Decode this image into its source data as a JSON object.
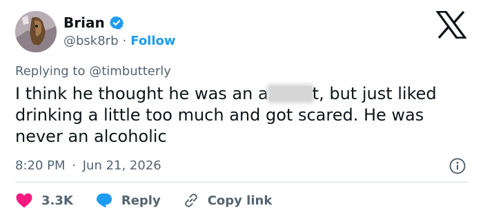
{
  "user": {
    "name": "Brian",
    "handle": "@bsk8rb",
    "separator": "·",
    "follow_label": "Follow"
  },
  "reply": {
    "prefix": "Replying to",
    "mention": "@timbutterly"
  },
  "tweet": {
    "text_before": "I think he thought he was an a",
    "text_after": "t, but just liked drinking a little too much and got scared. He was never an alcoholic"
  },
  "meta": {
    "time": "8:20 PM",
    "separator": "·",
    "date": "Jun 21, 2026"
  },
  "actions": {
    "likes": "3.3K",
    "reply_label": "Reply",
    "copy_label": "Copy link"
  },
  "colors": {
    "accent": "#1d9bf0",
    "like": "#f91880",
    "muted": "#536471",
    "text": "#0f1419"
  },
  "icons": [
    "verified-badge-icon",
    "x-logo-icon",
    "info-icon",
    "heart-icon",
    "reply-bubble-icon",
    "link-icon"
  ]
}
